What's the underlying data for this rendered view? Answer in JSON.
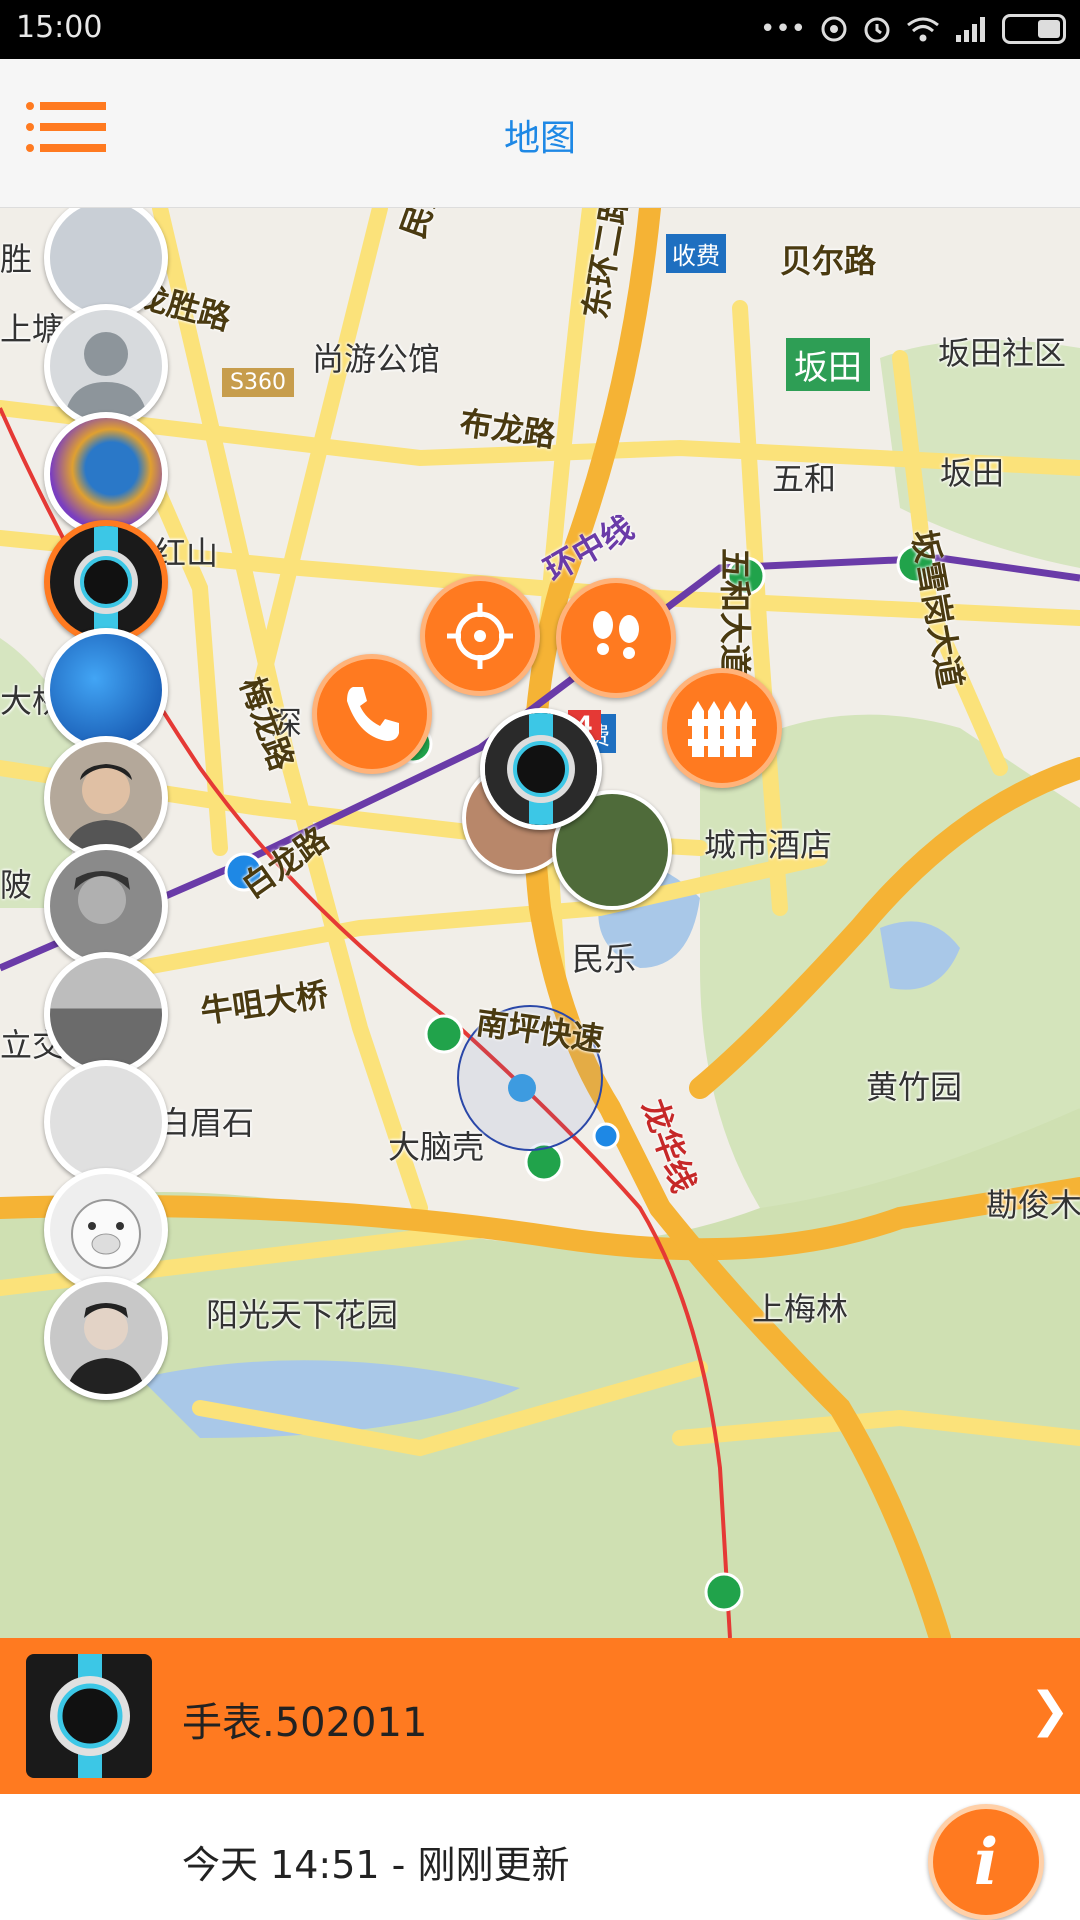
{
  "status_bar": {
    "time": "15:00",
    "icons": [
      "more-dots-icon",
      "hotspot-icon",
      "alarm-icon",
      "wifi-icon",
      "signal-icon",
      "battery-icon"
    ]
  },
  "header": {
    "title": "地图",
    "menu_icon": "hamburger-menu-icon"
  },
  "map": {
    "place_labels": [
      "胜",
      "尚游公馆",
      "坂田社区",
      "上塘",
      "五和",
      "坂田",
      "红山",
      "深",
      "城市酒店",
      "民乐",
      "黄竹园",
      "白眉石",
      "大脑壳",
      "勘俊木",
      "阳光天下花园",
      "上梅林",
      "陂",
      "立交",
      "大桥",
      "收费",
      "收费",
      "坂田"
    ],
    "road_labels": [
      "民清路",
      "东环二路",
      "贝尔路",
      "龙胜路",
      "S360",
      "布龙路",
      "民塘路",
      "环中线",
      "梅龙路",
      "五和大道",
      "坂雪岗大道",
      "白龙路",
      "牛咀大桥",
      "南坪快速",
      "龙华线",
      "4"
    ]
  },
  "avatars": [
    {
      "name": "avatar-screen-photo",
      "color": "#c9cfd6",
      "active": false
    },
    {
      "name": "avatar-default-person",
      "color": "#8d959b",
      "active": false
    },
    {
      "name": "avatar-colorful-pattern",
      "color": "#2a78c8",
      "active": false
    },
    {
      "name": "avatar-watch",
      "color": "#1a1a1a",
      "active": true
    },
    {
      "name": "avatar-blue-water",
      "color": "#1565c0",
      "active": false
    },
    {
      "name": "avatar-man-face",
      "color": "#9a8c80",
      "active": false
    },
    {
      "name": "avatar-gray-face",
      "color": "#6e6e6e",
      "active": false
    },
    {
      "name": "avatar-railway",
      "color": "#808080",
      "active": false
    },
    {
      "name": "avatar-sketch",
      "color": "#d2d2d2",
      "active": false
    },
    {
      "name": "avatar-piggy-toy",
      "color": "#e6e6e6",
      "active": false
    },
    {
      "name": "avatar-man-portrait",
      "color": "#bdbdbd",
      "active": false
    }
  ],
  "actions": [
    {
      "name": "locate-button",
      "icon": "crosshair-icon"
    },
    {
      "name": "footprints-button",
      "icon": "footprints-icon"
    },
    {
      "name": "call-button",
      "icon": "phone-icon"
    },
    {
      "name": "fence-button",
      "icon": "fence-icon"
    }
  ],
  "device": {
    "name": "手表.502011",
    "chevron": "❯"
  },
  "footer": {
    "update_text": "今天 14:51 - 刚刚更新",
    "info_label": "i"
  },
  "colors": {
    "accent": "#ff7a20",
    "title_blue": "#1e88e5"
  }
}
